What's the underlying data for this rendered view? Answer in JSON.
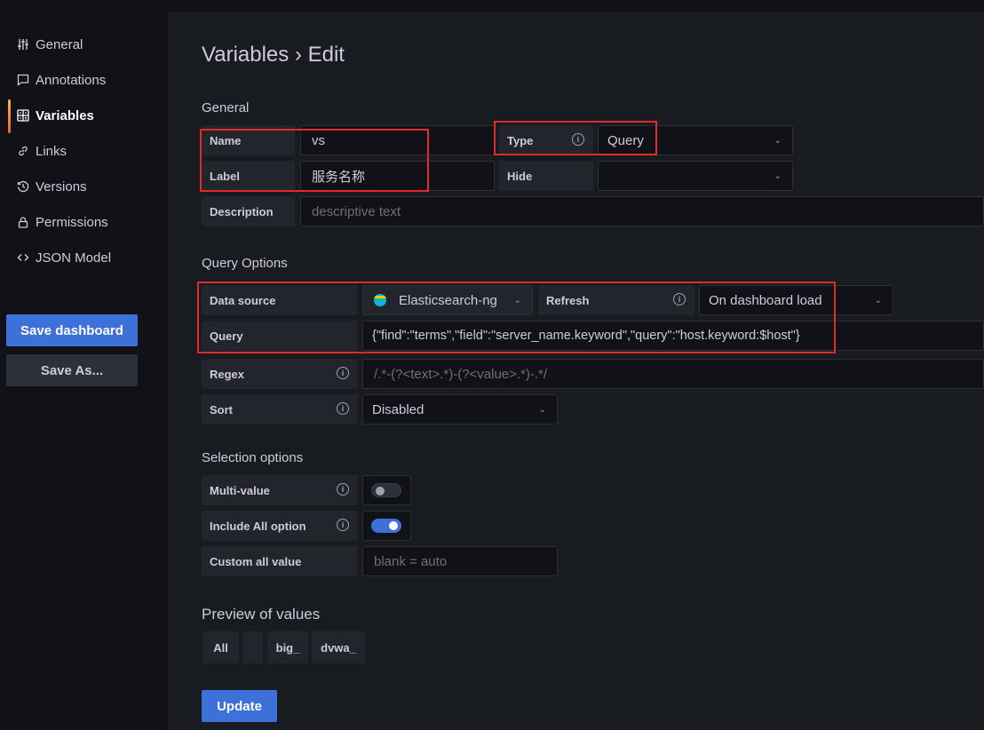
{
  "sidebar": {
    "items": [
      {
        "label": "General",
        "icon": "sliders-icon"
      },
      {
        "label": "Annotations",
        "icon": "comment-icon"
      },
      {
        "label": "Variables",
        "icon": "calculator-icon"
      },
      {
        "label": "Links",
        "icon": "link-icon"
      },
      {
        "label": "Versions",
        "icon": "history-icon"
      },
      {
        "label": "Permissions",
        "icon": "lock-icon"
      },
      {
        "label": "JSON Model",
        "icon": "code-icon"
      }
    ],
    "save_dashboard": "Save dashboard",
    "save_as": "Save As..."
  },
  "page": {
    "title": "Variables › Edit"
  },
  "general": {
    "title": "General",
    "name_label": "Name",
    "name_value": "vs",
    "type_label": "Type",
    "type_value": "Query",
    "label_label": "Label",
    "label_value": "服务名称",
    "hide_label": "Hide",
    "hide_value": "",
    "description_label": "Description",
    "description_placeholder": "descriptive text"
  },
  "query_options": {
    "title": "Query Options",
    "data_source_label": "Data source",
    "data_source_value": "Elasticsearch-ng",
    "refresh_label": "Refresh",
    "refresh_value": "On dashboard load",
    "query_label": "Query",
    "query_value": "{\"find\":\"terms\",\"field\":\"server_name.keyword\",\"query\":\"host.keyword:$host\"}",
    "regex_label": "Regex",
    "regex_placeholder": "/.*-(?<text>.*)-(?<value>.*)-.*/",
    "sort_label": "Sort",
    "sort_value": "Disabled"
  },
  "selection_options": {
    "title": "Selection options",
    "multi_value_label": "Multi-value",
    "multi_value_enabled": false,
    "include_all_label": "Include All option",
    "include_all_enabled": true,
    "custom_all_label": "Custom all value",
    "custom_all_placeholder": "blank = auto"
  },
  "preview": {
    "title": "Preview of values",
    "values": [
      "All",
      "",
      "big_",
      "dvwa_"
    ]
  },
  "update_label": "Update",
  "colors": {
    "primary": "#3d71d9",
    "highlight": "#e32a2a",
    "active_bar": "#f5b73d"
  }
}
